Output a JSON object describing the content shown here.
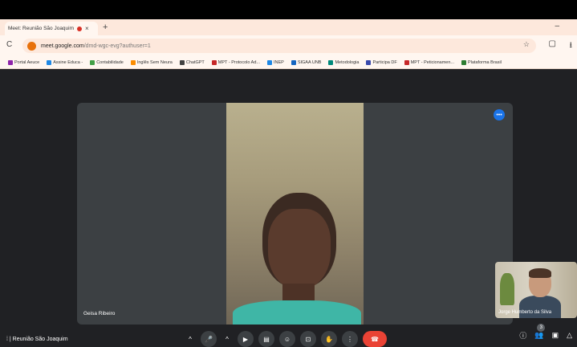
{
  "browser": {
    "tab_title": "Meet: Reunião São Joaquim",
    "tab_close": "×",
    "new_tab": "+",
    "minimize": "–",
    "reload": "C",
    "url_host": "meet.google.com",
    "url_path": "/dmd-wgc-evg?authuser=1",
    "star": "☆",
    "extensions": "▢",
    "download": "⭳"
  },
  "bookmarks": [
    {
      "label": "Portal Aeuce",
      "color": "#8e24aa"
    },
    {
      "label": "Assine Educa -",
      "color": "#1e88e5"
    },
    {
      "label": "Contabilidade",
      "color": "#43a047"
    },
    {
      "label": "Inglês Sem Neura",
      "color": "#fb8c00"
    },
    {
      "label": "ChatGPT",
      "color": "#424242"
    },
    {
      "label": "MPT - Protocolo Ad...",
      "color": "#c62828"
    },
    {
      "label": "INEP",
      "color": "#1e88e5"
    },
    {
      "label": "SIGAA UNB",
      "color": "#1565c0"
    },
    {
      "label": "Metodologia",
      "color": "#00897b"
    },
    {
      "label": "Participa DF",
      "color": "#3949ab"
    },
    {
      "label": "MPT - Peticionamen...",
      "color": "#c62828"
    },
    {
      "label": "Plataforma Brasil",
      "color": "#2e7d32"
    }
  ],
  "meet": {
    "main_participant": "Geisa Ribeiro",
    "self_participant": "Jorge Humberto da Silva",
    "meeting_title": "Reunião São Joaquim",
    "participant_count": "3",
    "speaker_icon": "⬤"
  },
  "controls": {
    "more_mic": "^",
    "mic": "🎤",
    "more_cam": "^",
    "camera": "▶",
    "captions": "▤",
    "emoji": "☺",
    "present": "⊡",
    "raise_hand": "✋",
    "more_options": "⋮",
    "hangup": "☎",
    "info": "ⓘ",
    "people": "👥",
    "chat": "▣",
    "activities": "△"
  }
}
